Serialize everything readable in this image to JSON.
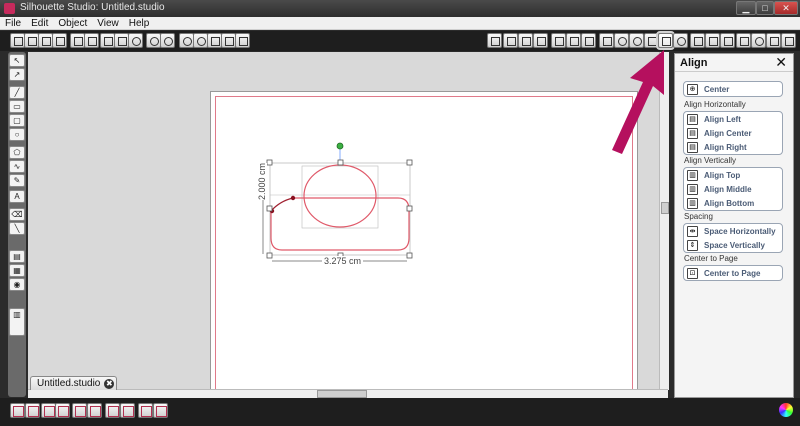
{
  "window": {
    "title": "Silhouette Studio: Untitled.studio"
  },
  "menu": [
    "File",
    "Edit",
    "Object",
    "View",
    "Help"
  ],
  "document": {
    "tab_label": "Untitled.studio",
    "close_glyph": "✖"
  },
  "selection": {
    "width_label": "3.275 cm",
    "height_label": "2.000 cm"
  },
  "panel": {
    "title": "Align",
    "close_glyph": "✕",
    "center_btn": "Center",
    "section_horizontal": "Align Horizontally",
    "horizontal": [
      "Align Left",
      "Align Center",
      "Align Right"
    ],
    "section_vertical": "Align Vertically",
    "vertical": [
      "Align Top",
      "Align Middle",
      "Align Bottom"
    ],
    "section_spacing": "Spacing",
    "spacing": [
      "Space Horizontally",
      "Space Vertically"
    ],
    "section_page": "Center to Page",
    "page_btn": "Center to Page"
  },
  "colors": {
    "accent_arrow": "#b5105e",
    "shape_stroke": "#e05a6a",
    "label_text": "#4a5b75"
  },
  "icons": {
    "window_minimize": "minimize-icon",
    "window_maximize": "maximize-icon",
    "window_close": "close-icon"
  }
}
